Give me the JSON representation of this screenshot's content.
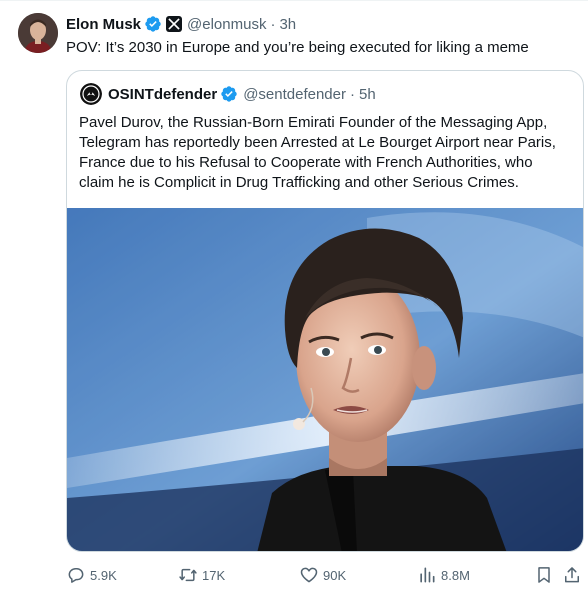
{
  "author": {
    "name": "Elon Musk",
    "handle": "@elonmusk",
    "separator": "·",
    "time": "3h"
  },
  "tweet_text": "POV: It’s 2030 in Europe and you’re being executed for liking a meme",
  "quoted": {
    "name": "OSINTdefender",
    "handle": "@sentdefender",
    "separator": "·",
    "time": "5h",
    "lines": [
      "Pavel Durov, the Russian-Born Emirati Founder of the Messaging App,",
      "Telegram has reportedly been Arrested at Le Bourget Airport near Paris,",
      "France due to his Refusal to Cooperate with French Authorities, who",
      "claim he is Complicit in Drug Trafficking and other Serious Crimes."
    ]
  },
  "actions": {
    "replies": "5.9K",
    "reposts": "17K",
    "likes": "90K",
    "views": "8.8M"
  },
  "icons": {
    "verified": "verified-badge-icon",
    "affiliate": "x-logo-icon",
    "reply": "reply-icon",
    "repost": "repost-icon",
    "like": "heart-icon",
    "views": "views-icon",
    "bookmark": "bookmark-icon",
    "share": "share-icon"
  },
  "colors": {
    "verified_blue": "#1d9bf0",
    "text_primary": "#0f1419",
    "text_secondary": "#536471",
    "border": "#cfd9de"
  }
}
